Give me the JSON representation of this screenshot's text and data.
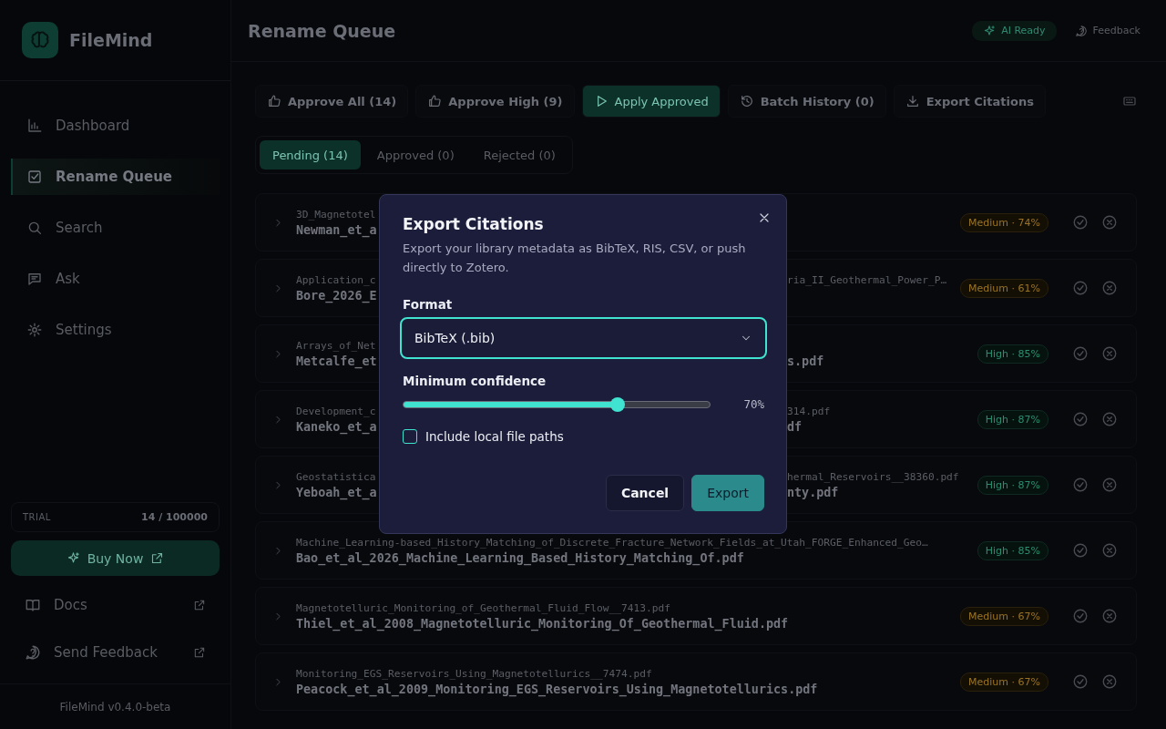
{
  "sidebar": {
    "brand": "FileMind",
    "nav": [
      {
        "label": "Dashboard",
        "selected": false
      },
      {
        "label": "Rename Queue",
        "selected": true
      },
      {
        "label": "Search",
        "selected": false
      },
      {
        "label": "Ask",
        "selected": false
      },
      {
        "label": "Settings",
        "selected": false
      }
    ],
    "trial": {
      "label": "TRIAL",
      "count": "14 / 100000"
    },
    "buy_button": "Buy Now",
    "links": [
      {
        "label": "Docs"
      },
      {
        "label": "Send Feedback"
      }
    ],
    "version": "FileMind v0.4.0-beta"
  },
  "header": {
    "title": "Rename Queue",
    "status": "AI Ready",
    "feedback": "Feedback"
  },
  "toolbar": [
    {
      "label": "Approve All (14)",
      "primary": false
    },
    {
      "label": "Approve High (9)",
      "primary": false
    },
    {
      "label": "Apply Approved",
      "primary": true
    },
    {
      "label": "Batch History (0)",
      "primary": false
    },
    {
      "label": "Export Citations",
      "primary": false
    }
  ],
  "tabs": [
    {
      "label": "Pending (14)",
      "selected": true
    },
    {
      "label": "Approved (0)",
      "selected": false
    },
    {
      "label": "Rejected (0)",
      "selected": false
    }
  ],
  "rows": [
    {
      "original": {
        "left": "3D_Magnetotel"
      },
      "proposed": {
        "left": "Newman_et_a"
      },
      "badge": {
        "text": "Medium · 74%",
        "kind": "medium"
      }
    },
    {
      "original": {
        "left": "Application_c",
        "right": "ria_II_Geothermal_Power_P…"
      },
      "proposed": {
        "left": "Bore_2026_E"
      },
      "badge": {
        "text": "Medium · 61%",
        "kind": "medium"
      }
    },
    {
      "original": {
        "left": "Arrays_of_Net"
      },
      "proposed": {
        "left": "Metcalfe_et",
        "right": "s.pdf"
      },
      "badge": {
        "text": "High · 85%",
        "kind": "high"
      }
    },
    {
      "original": {
        "left": "Development_c",
        "right": "314.pdf"
      },
      "proposed": {
        "left": "Kaneko_et_a",
        "right": "df"
      },
      "badge": {
        "text": "High · 87%",
        "kind": "high"
      }
    },
    {
      "original": {
        "left": "Geostatistica",
        "right": "hermal_Reservoirs__38360.pdf"
      },
      "proposed": {
        "left": "Yeboah_et_a",
        "right": "nty.pdf"
      },
      "badge": {
        "text": "High · 87%",
        "kind": "high"
      }
    },
    {
      "original": {
        "full": "Machine_Learning-based_History_Matching_of_Discrete_Fracture_Network_Fields_at_Utah_FORGE_Enhanced_Geo…"
      },
      "proposed": {
        "full": "Bao_et_al_2026_Machine_Learning_Based_History_Matching_Of.pdf"
      },
      "badge": {
        "text": "High · 85%",
        "kind": "high"
      }
    },
    {
      "original": {
        "full": "Magnetotelluric_Monitoring_of_Geothermal_Fluid_Flow__7413.pdf"
      },
      "proposed": {
        "full": "Thiel_et_al_2008_Magnetotelluric_Monitoring_Of_Geothermal_Fluid.pdf"
      },
      "badge": {
        "text": "Medium · 67%",
        "kind": "medium"
      }
    },
    {
      "original": {
        "full": "Monitoring_EGS_Reservoirs_Using_Magnetotellurics__7474.pdf"
      },
      "proposed": {
        "full": "Peacock_et_al_2009_Monitoring_EGS_Reservoirs_Using_Magnetotellurics.pdf"
      },
      "badge": {
        "text": "Medium · 67%",
        "kind": "medium"
      }
    }
  ],
  "dialog": {
    "title": "Export Citations",
    "description": "Export your library metadata as BibTeX, RIS, CSV, or push directly to Zotero.",
    "format": {
      "label": "Format",
      "value": "BibTeX (.bib)",
      "focused": true
    },
    "confidence": {
      "label": "Minimum confidence",
      "level": 0.7,
      "reading": "70%"
    },
    "include_paths": {
      "label": "Include local file paths",
      "checked": false
    },
    "buttons": [
      {
        "label": "Cancel",
        "primary": false
      },
      {
        "label": "Export",
        "primary": true
      }
    ]
  }
}
